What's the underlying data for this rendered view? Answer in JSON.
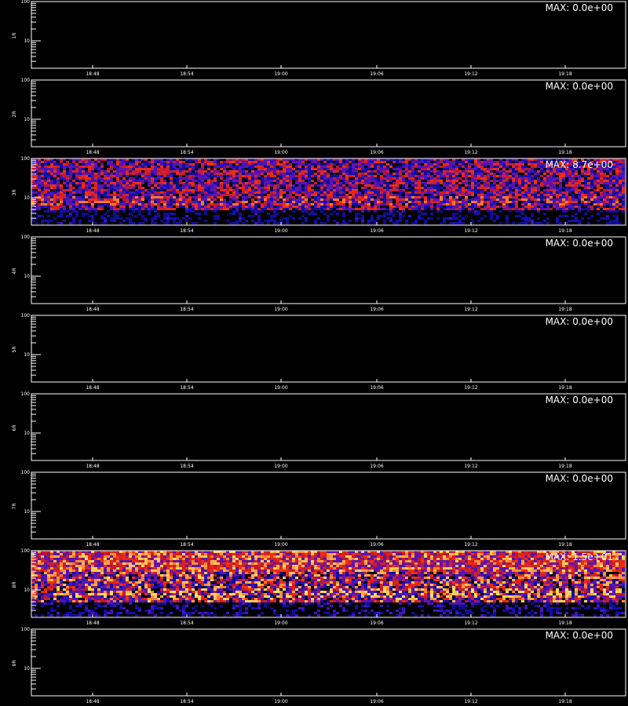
{
  "colors": {
    "background": "#000000",
    "axes": "#ffffff",
    "low": "#1010c0",
    "mid": "#d02020",
    "high": "#ffe040"
  },
  "x_ticks": [
    "18:48",
    "18:54",
    "19:00",
    "19:06",
    "19:12",
    "19:18"
  ],
  "y_ticks": [
    "100",
    "10"
  ],
  "chart_data": [
    {
      "type": "heatmap",
      "ylabel": "1R",
      "max_label": "MAX: 0.0e+00",
      "max": 0.0,
      "x_ticks": [
        "18:48",
        "18:54",
        "19:00",
        "19:06",
        "19:12",
        "19:18"
      ],
      "y_ticks": [
        "100",
        "10"
      ],
      "y_scale": "log"
    },
    {
      "type": "heatmap",
      "ylabel": "2R",
      "max_label": "MAX: 0.0e+00",
      "max": 0.0,
      "x_ticks": [
        "18:48",
        "18:54",
        "19:00",
        "19:06",
        "19:12",
        "19:18"
      ],
      "y_ticks": [
        "100",
        "10"
      ],
      "y_scale": "log"
    },
    {
      "type": "heatmap",
      "ylabel": "3R",
      "max_label": "MAX: 8.7e+00",
      "max": 8.7,
      "x_ticks": [
        "18:48",
        "18:54",
        "19:00",
        "19:06",
        "19:12",
        "19:18"
      ],
      "y_ticks": [
        "100",
        "10"
      ],
      "y_scale": "log"
    },
    {
      "type": "heatmap",
      "ylabel": "4R",
      "max_label": "MAX: 0.0e+00",
      "max": 0.0,
      "x_ticks": [
        "18:48",
        "18:54",
        "19:00",
        "19:06",
        "19:12",
        "19:18"
      ],
      "y_ticks": [
        "100",
        "10"
      ],
      "y_scale": "log"
    },
    {
      "type": "heatmap",
      "ylabel": "5R",
      "max_label": "MAX: 0.0e+00",
      "max": 0.0,
      "x_ticks": [
        "18:48",
        "18:54",
        "19:00",
        "19:06",
        "19:12",
        "19:18"
      ],
      "y_ticks": [
        "100",
        "10"
      ],
      "y_scale": "log"
    },
    {
      "type": "heatmap",
      "ylabel": "6R",
      "max_label": "MAX: 0.0e+00",
      "max": 0.0,
      "x_ticks": [
        "18:48",
        "18:54",
        "19:00",
        "19:06",
        "19:12",
        "19:18"
      ],
      "y_ticks": [
        "100",
        "10"
      ],
      "y_scale": "log"
    },
    {
      "type": "heatmap",
      "ylabel": "7R",
      "max_label": "MAX: 0.0e+00",
      "max": 0.0,
      "x_ticks": [
        "18:48",
        "18:54",
        "19:00",
        "19:06",
        "19:12",
        "19:18"
      ],
      "y_ticks": [
        "100",
        "10"
      ],
      "y_scale": "log"
    },
    {
      "type": "heatmap",
      "ylabel": "8R",
      "max_label": "MAX: 1.5e+01",
      "max": 15.0,
      "x_ticks": [
        "18:48",
        "18:54",
        "19:00",
        "19:06",
        "19:12",
        "19:18"
      ],
      "y_ticks": [
        "100",
        "10"
      ],
      "y_scale": "log"
    },
    {
      "type": "heatmap",
      "ylabel": "9R",
      "max_label": "MAX: 0.0e+00",
      "max": 0.0,
      "x_ticks": [
        "18:48",
        "18:54",
        "19:00",
        "19:06",
        "19:12",
        "19:18"
      ],
      "y_ticks": [
        "100",
        "10"
      ],
      "y_scale": "log"
    }
  ]
}
